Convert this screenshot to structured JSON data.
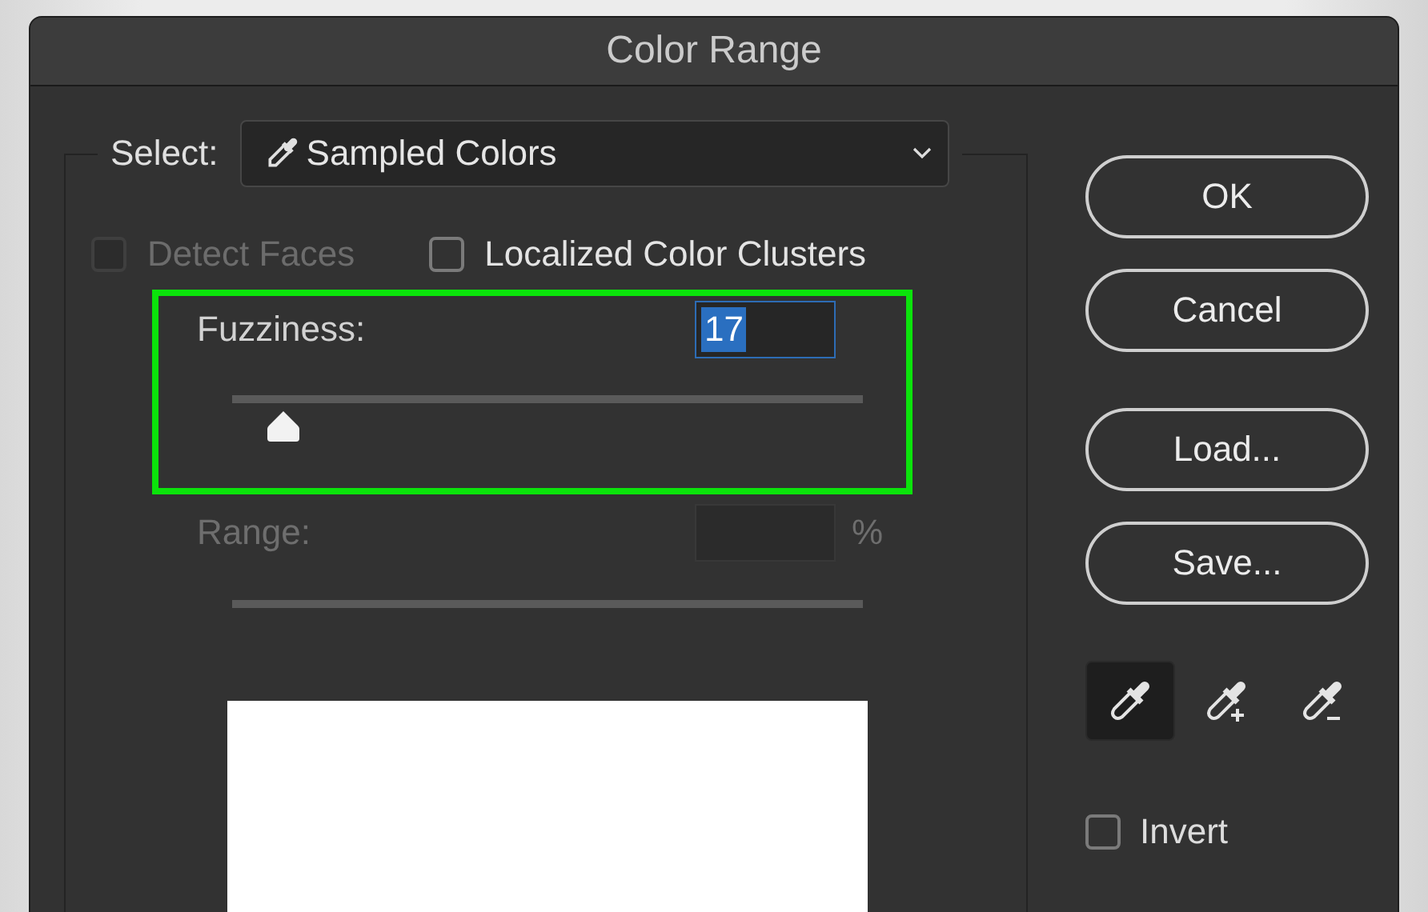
{
  "window": {
    "title": "Color Range"
  },
  "select": {
    "label": "Select:",
    "value": "Sampled Colors"
  },
  "options": [
    {
      "label": "Detect Faces",
      "checked": false,
      "disabled": true
    },
    {
      "label": "Localized Color Clusters",
      "checked": false,
      "disabled": false
    }
  ],
  "fuzziness": {
    "label": "Fuzziness:",
    "value": "17",
    "level": 0.08,
    "highlighted": true
  },
  "range": {
    "label": "Range:",
    "unit": "%",
    "disabled": true
  },
  "button_groups": [
    [
      "OK",
      "Cancel"
    ],
    [
      "Load...",
      "Save..."
    ]
  ],
  "tools": [
    {
      "kind": "sample",
      "selected": true
    },
    {
      "kind": "add",
      "selected": false
    },
    {
      "kind": "subtract",
      "selected": false
    }
  ],
  "invert": {
    "label": "Invert",
    "checked": false
  }
}
